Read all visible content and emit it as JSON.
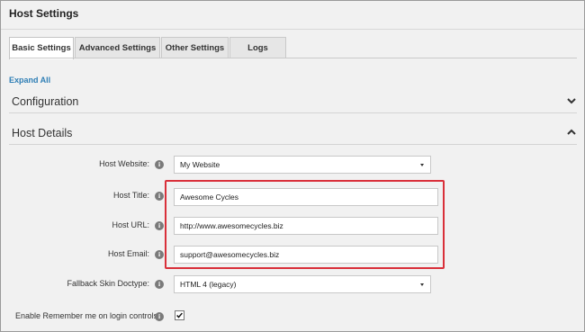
{
  "page": {
    "title": "Host Settings"
  },
  "tabs": [
    {
      "label": "Basic Settings",
      "active": true
    },
    {
      "label": "Advanced Settings",
      "active": false
    },
    {
      "label": "Other Settings",
      "active": false
    },
    {
      "label": "Logs",
      "active": false
    }
  ],
  "expand_all": "Expand All",
  "sections": {
    "configuration": {
      "label": "Configuration",
      "state": "collapsed",
      "icon": "chevron-down-icon"
    },
    "host_details": {
      "label": "Host Details",
      "state": "expanded",
      "icon": "chevron-up-icon"
    }
  },
  "fields": {
    "host_website": {
      "label": "Host Website:",
      "value": "My Website"
    },
    "host_title": {
      "label": "Host Title:",
      "value": "Awesome Cycles"
    },
    "host_url": {
      "label": "Host URL:",
      "value": "http://www.awesomecycles.biz"
    },
    "host_email": {
      "label": "Host Email:",
      "value": "support@awesomecycles.biz"
    },
    "fallback_skin_doctype": {
      "label": "Fallback Skin Doctype:",
      "value": "HTML 4 (legacy)"
    },
    "remember_me": {
      "label": "Enable Remember me on login controls?",
      "checked": true
    }
  },
  "info_icon_glyph": "i",
  "colors": {
    "link": "#2e7eb5",
    "highlight_border": "#d9303a"
  }
}
